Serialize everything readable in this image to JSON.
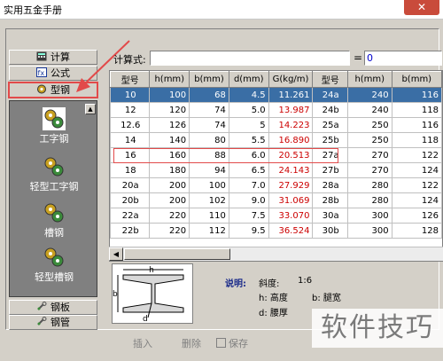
{
  "window": {
    "title": "实用五金手册",
    "close_glyph": "✕"
  },
  "nav": {
    "tabs": [
      {
        "label": "计算",
        "icon": "calculator-icon"
      },
      {
        "label": "公式",
        "icon": "formula-icon"
      },
      {
        "label": "型钢",
        "icon": "gear-icon",
        "active": true
      }
    ],
    "items": [
      {
        "label": "工字钢",
        "icon": "gear-icon",
        "selected": true
      },
      {
        "label": "轻型工字钢",
        "icon": "gear-icon"
      },
      {
        "label": "槽钢",
        "icon": "gear-icon"
      },
      {
        "label": "轻型槽钢",
        "icon": "gear-icon"
      }
    ],
    "bottom_tabs": [
      {
        "label": "钢板",
        "icon": "wrench-icon"
      },
      {
        "label": "钢管",
        "icon": "wrench-icon"
      }
    ],
    "scroll_up_glyph": "▲"
  },
  "calc": {
    "label": "计算式:",
    "expression": "",
    "equals": "=",
    "result": "0"
  },
  "table": {
    "headers": [
      "型号",
      "h(mm)",
      "b(mm)",
      "d(mm)",
      "G(kg/m)",
      "型号",
      "h(mm)",
      "b(mm)"
    ],
    "rows": [
      [
        "10",
        "100",
        "68",
        "4.5",
        "11.261",
        "24a",
        "240",
        "116"
      ],
      [
        "12",
        "120",
        "74",
        "5.0",
        "13.987",
        "24b",
        "240",
        "118"
      ],
      [
        "12.6",
        "126",
        "74",
        "5",
        "14.223",
        "25a",
        "250",
        "116"
      ],
      [
        "14",
        "140",
        "80",
        "5.5",
        "16.890",
        "25b",
        "250",
        "118"
      ],
      [
        "16",
        "160",
        "88",
        "6.0",
        "20.513",
        "27a",
        "270",
        "122"
      ],
      [
        "18",
        "180",
        "94",
        "6.5",
        "24.143",
        "27b",
        "270",
        "124"
      ],
      [
        "20a",
        "200",
        "100",
        "7.0",
        "27.929",
        "28a",
        "280",
        "122"
      ],
      [
        "20b",
        "200",
        "102",
        "9.0",
        "31.069",
        "28b",
        "280",
        "124"
      ],
      [
        "22a",
        "220",
        "110",
        "7.5",
        "33.070",
        "30a",
        "300",
        "126"
      ],
      [
        "22b",
        "220",
        "112",
        "9.5",
        "36.524",
        "30b",
        "300",
        "128"
      ]
    ],
    "selected_row": 0,
    "highlighted_row": 4
  },
  "scroll_left_glyph": "◀",
  "diagram": {
    "label_h": "h",
    "label_b": "b",
    "label_d": "d"
  },
  "description": {
    "title": "说明:",
    "slope_label": "斜度:",
    "slope_value": "1:6",
    "h_label": "h: 高度",
    "b_label": "b: 腿宽",
    "d_label": "d: 腰厚"
  },
  "toolbar": {
    "insert": "插入",
    "delete": "删除",
    "save": "保存"
  },
  "watermark": "软件技巧"
}
